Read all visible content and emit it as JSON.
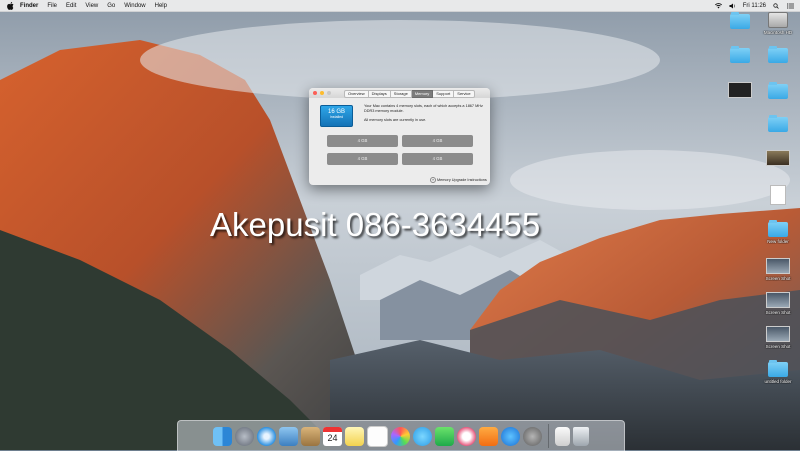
{
  "menubar": {
    "apple": "",
    "menus": [
      "Finder",
      "File",
      "Edit",
      "View",
      "Go",
      "Window",
      "Help"
    ],
    "clock": "Fri 11:26"
  },
  "desktop_icons": [
    {
      "name": "Macintosh HD",
      "kind": "drive"
    },
    {
      "name": "",
      "kind": "folder"
    },
    {
      "name": "",
      "kind": "folder"
    },
    {
      "name": "",
      "kind": "folder"
    },
    {
      "name": "",
      "kind": "folder"
    },
    {
      "name": "",
      "kind": "thumb"
    },
    {
      "name": "",
      "kind": "folder"
    },
    {
      "name": "",
      "kind": "folder"
    },
    {
      "name": "",
      "kind": "photo"
    },
    {
      "name": "",
      "kind": "doc"
    },
    {
      "name": "New folder",
      "kind": "folder"
    },
    {
      "name": "Screen Shot",
      "kind": "shot"
    },
    {
      "name": "Screen Shot",
      "kind": "shot"
    },
    {
      "name": "Screen Shot",
      "kind": "shot"
    },
    {
      "name": "untitled folder",
      "kind": "folder"
    }
  ],
  "window": {
    "tabs": [
      "Overview",
      "Displays",
      "Storage",
      "Memory",
      "Support",
      "Service"
    ],
    "active_tab": "Memory",
    "badge_size": "16 GB",
    "badge_label": "Installed",
    "description": "Your Mac contains 4 memory slots, each of which accepts a 1867 MHz DDR3 memory module.",
    "slots_status": "All memory slots are currently in use.",
    "slots": [
      "4 GB",
      "4 GB",
      "4 GB",
      "4 GB"
    ],
    "upgrade_link": "Memory Upgrade Instructions"
  },
  "watermark": "Akepusit  086-3634455",
  "dock": {
    "apps": [
      "Finder",
      "Launchpad",
      "Safari",
      "Preview",
      "Contacts",
      "Calendar",
      "Notes",
      "Reminders",
      "Photos",
      "Messages",
      "FaceTime",
      "iTunes",
      "iBooks",
      "App Store",
      "System Preferences"
    ],
    "calendar_day": "24",
    "trash": "Trash"
  }
}
